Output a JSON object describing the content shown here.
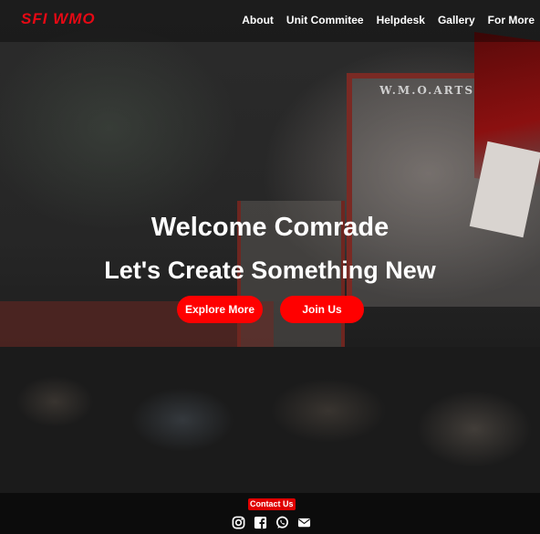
{
  "brand": {
    "logo_text": "SFI WMO",
    "logo_color": "#e50914"
  },
  "nav": {
    "items": [
      {
        "label": "About"
      },
      {
        "label": "Unit Commitee"
      },
      {
        "label": "Helpdesk"
      },
      {
        "label": "Gallery"
      },
      {
        "label": "For More"
      }
    ]
  },
  "hero": {
    "heading": "Welcome Comrade",
    "subheading": "Let's Create Something New",
    "background_sign": "W.M.O.ARTS & S",
    "explore_label": "Explore More",
    "join_label": "Join Us",
    "accent": "#ff0000"
  },
  "footer": {
    "contact_label": "Contact Us",
    "socials": [
      "instagram-icon",
      "facebook-icon",
      "whatsapp-icon",
      "email-icon"
    ]
  }
}
